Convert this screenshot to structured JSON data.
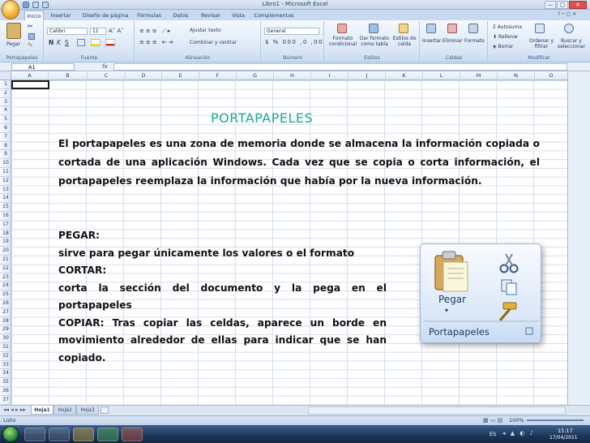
{
  "window": {
    "title": "Libro1 - Microsoft Excel",
    "controls": [
      "—",
      "▢",
      "✕"
    ]
  },
  "ribbon": {
    "tabs": [
      "Inicio",
      "Insertar",
      "Diseño de página",
      "Fórmulas",
      "Datos",
      "Revisar",
      "Vista",
      "Complementos"
    ],
    "active_tab": "Inicio",
    "paste_label": "Pegar",
    "font_name": "Calibri",
    "font_size": "11",
    "wrap_text": "Ajustar texto",
    "merge_center": "Combinar y centrar",
    "number_format": "General",
    "cond_format": "Formato condicional",
    "table_format": "Dar formato como tabla",
    "cell_styles": "Estilos de celda",
    "insert": "Insertar",
    "delete": "Eliminar",
    "format": "Formato",
    "autosum": "Autosuma",
    "fill": "Rellenar",
    "clear": "Borrar",
    "sort_filter": "Ordenar y filtrar",
    "find_select": "Buscar y seleccionar",
    "groups": {
      "clipboard": "Portapapeles",
      "font": "Fuente",
      "alignment": "Alineación",
      "number": "Número",
      "styles": "Estilos",
      "cells": "Celdas",
      "modify": "Modificar"
    }
  },
  "formula_bar": {
    "name_box": "A1",
    "fx": "fx"
  },
  "grid": {
    "columns": [
      "A",
      "B",
      "C",
      "D",
      "E",
      "F",
      "G",
      "H",
      "I",
      "J",
      "K",
      "L",
      "M",
      "N",
      "O"
    ],
    "rows": [
      "1",
      "2",
      "3",
      "4",
      "5",
      "6",
      "7",
      "8",
      "9",
      "10",
      "11",
      "12",
      "13",
      "14",
      "15",
      "16",
      "17",
      "18",
      "19",
      "20",
      "21",
      "22",
      "23",
      "24",
      "25",
      "26",
      "27",
      "28",
      "29",
      "30",
      "31",
      "32",
      "33",
      "34",
      "35",
      "36",
      "37"
    ]
  },
  "sheets": [
    "Hoja1",
    "Hoja2",
    "Hoja3"
  ],
  "status": {
    "mode": "Listo",
    "zoom": "100%"
  },
  "taskbar": {
    "language": "ES",
    "time": "15:17",
    "date": "17/04/2011"
  },
  "slide": {
    "heading": "PORTAPAPELES",
    "paragraph": "El portapapeles es una zona de memoria donde se almacena la información copiada o cortada de una aplicación Windows. Cada vez que se copia o corta información, el portapapeles reemplaza la información que había por la nueva información.",
    "pegar_title": "PEGAR:",
    "pegar_desc": "sirve para pegar únicamente los valores o el formato",
    "cortar_title": "CORTAR:",
    "cortar_desc": "corta la sección del documento y la pega en el portapapeles",
    "copiar_desc": "COPIAR: Tras copiar las celdas, aparece un borde en movimiento alrededor de ellas para indicar que se han copiado.",
    "image": {
      "paste_label": "Pegar",
      "group_label": "Portapapeles"
    }
  }
}
